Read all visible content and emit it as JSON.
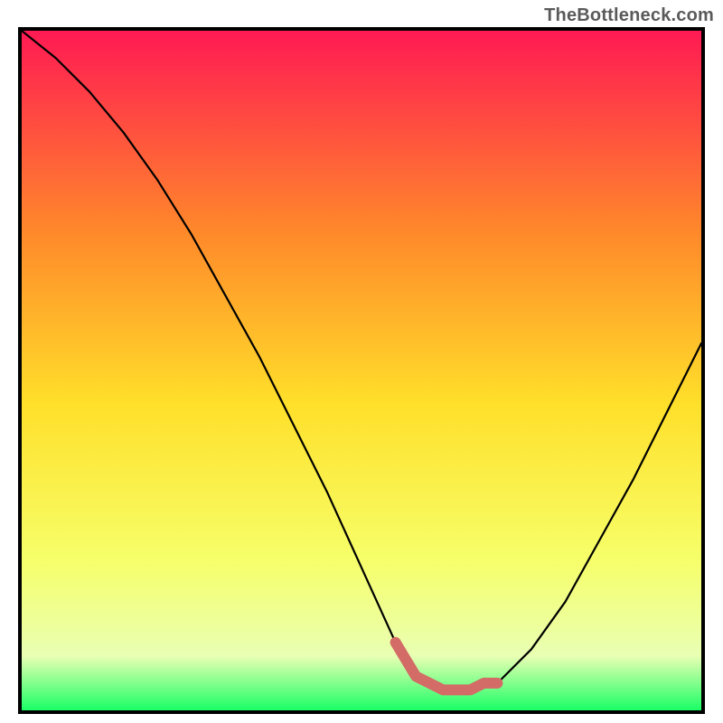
{
  "watermark": "TheBottleneck.com",
  "colors": {
    "frame": "#000000",
    "curve": "#000000",
    "flat_marker": "#d36b66",
    "grad_top": "#ff1a53",
    "grad_mid_upper": "#ff8a2a",
    "grad_mid": "#ffe02a",
    "grad_mid_lower": "#f6ff6a",
    "grad_lower": "#e9ffb3",
    "grad_bottom": "#1aff66"
  },
  "chart_data": {
    "type": "line",
    "title": "",
    "xlabel": "",
    "ylabel": "",
    "xlim": [
      0,
      100
    ],
    "ylim": [
      0,
      100
    ],
    "series": [
      {
        "name": "bottleneck-curve",
        "x": [
          0,
          5,
          10,
          15,
          20,
          25,
          30,
          35,
          40,
          45,
          50,
          55,
          58,
          62,
          66,
          70,
          75,
          80,
          85,
          90,
          95,
          100
        ],
        "values": [
          100,
          96,
          91,
          85,
          78,
          70,
          61,
          52,
          42,
          32,
          21,
          10,
          5,
          3,
          3,
          4,
          9,
          16,
          25,
          34,
          44,
          54
        ]
      }
    ],
    "flat_region": {
      "name": "optimal-range-marker",
      "x": [
        55,
        58,
        60,
        62,
        64,
        66,
        68,
        70
      ],
      "values": [
        10,
        5,
        4,
        3,
        3,
        3,
        4,
        4
      ]
    },
    "legend": false,
    "grid": false
  }
}
